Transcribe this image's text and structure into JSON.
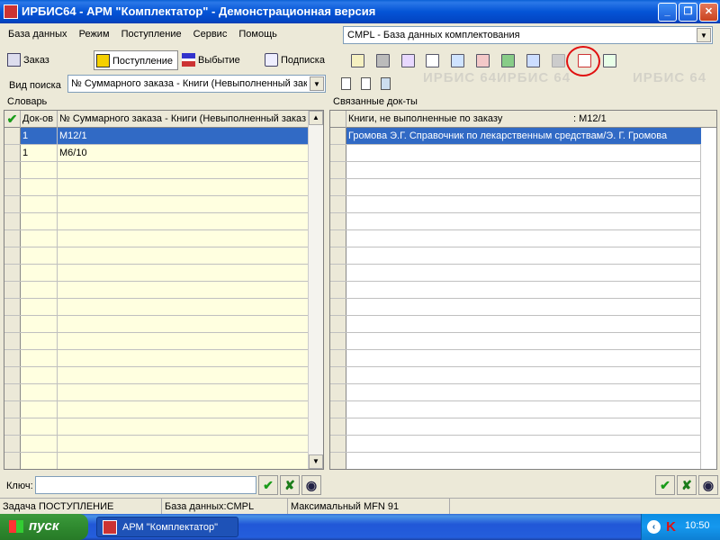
{
  "window": {
    "title": "ИРБИС64 - АРМ \"Комплектатор\" - Демонстрационная версия"
  },
  "menu": [
    "База данных",
    "Режим",
    "Поступление",
    "Сервис",
    "Помощь"
  ],
  "background_logo": "ИРБИС 64",
  "database": {
    "selected": "CMPL - База данных комплектования"
  },
  "tabs": [
    {
      "label": "Заказ",
      "active": false
    },
    {
      "label": "Поступление",
      "active": true
    },
    {
      "label": "Выбытие",
      "active": false
    },
    {
      "label": "Подписка",
      "active": false
    }
  ],
  "search": {
    "label": "Вид поиска",
    "mode": "№ Суммарного заказа - Книги (Невыполненный зак"
  },
  "dictionary": {
    "caption": "Словарь",
    "columns": [
      "Док-ов",
      "№ Суммарного заказа - Книги (Невыполненный заказ"
    ],
    "rows": [
      {
        "count": "1",
        "term": "M12/1",
        "selected": true
      },
      {
        "count": "1",
        "term": "M6/10",
        "selected": false
      }
    ]
  },
  "linked": {
    "caption": "Связанные док-ты",
    "header_title": "Книги, не выполненные по заказу",
    "header_value": ": M12/1",
    "rows": [
      {
        "text": "Громова Э.Г. Справочник по лекарственным средствам/Э. Г. Громова",
        "selected": true
      }
    ]
  },
  "key": {
    "label": "Ключ:",
    "value": ""
  },
  "status": {
    "task": "Задача ПОСТУПЛЕНИЕ",
    "db": "База данных:CMPL",
    "mfn": "Максимальный MFN 91"
  },
  "taskbar": {
    "start": "пуск",
    "item": "АРМ \"Комплектатор\"",
    "clock": "10:50"
  },
  "colors": {
    "title_bar": "#0454d6",
    "selection": "#316ac5",
    "highlight_ring": "#e01010",
    "dictionary_bg": "#ffffe0"
  }
}
